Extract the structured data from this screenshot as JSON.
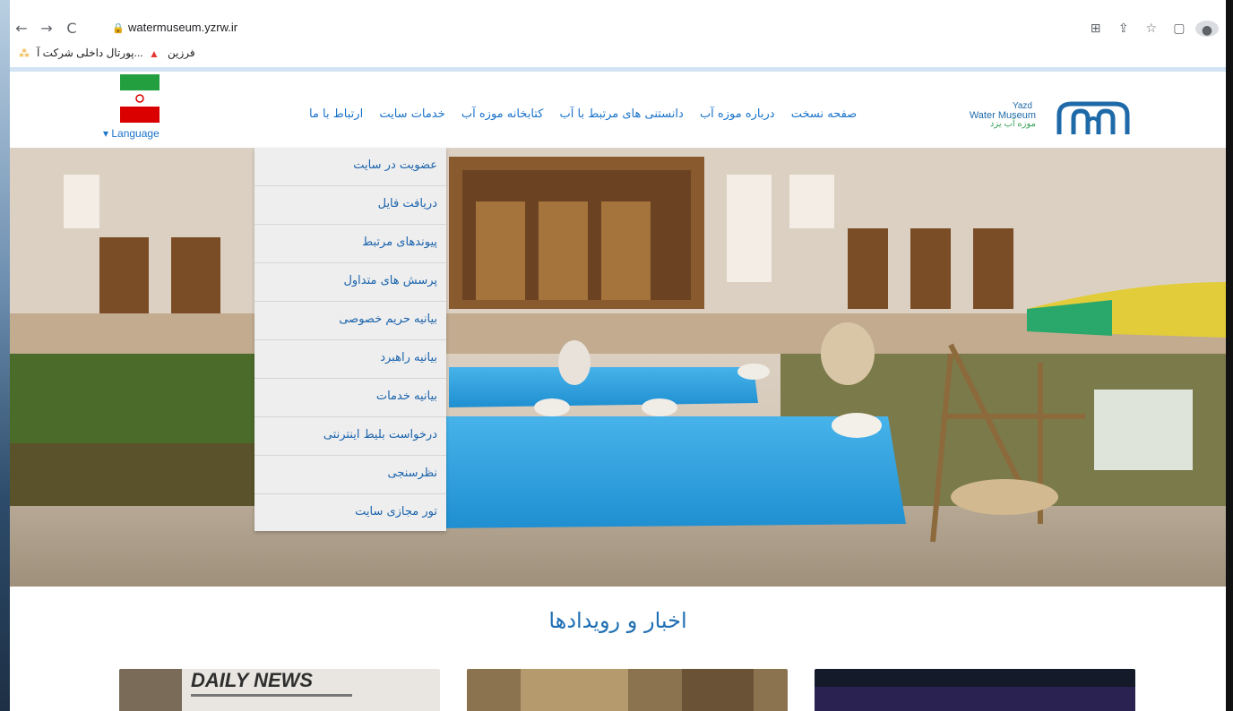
{
  "browser": {
    "url": "watermuseum.yzrw.ir",
    "bookmarks": [
      "فرزین",
      "پورتال داخلی شرکت آ..."
    ]
  },
  "site": {
    "logo": {
      "en_city": "Yazd",
      "en_name": "Water Museum",
      "fa_name": "موزه آب یزد"
    },
    "nav": [
      "صفحه نسخت",
      "درباره موزه آب",
      "دانستنی های مرتبط با آب",
      "کتابخانه موزه آب",
      "خدمات سایت",
      "ارتباط با ما"
    ],
    "language_label": "▾ Language",
    "dropdown": [
      "عضویت در سایت",
      "دریافت فایل",
      "پیوندهای مرتبط",
      "پرسش های متداول",
      "بیانیه حریم خصوصی",
      "بیانیه راهبرد",
      "بیانیه خدمات",
      "درخواست بلیط اینترنتی",
      "نظرسنجی",
      "تور مجازی سایت"
    ],
    "news_title": "اخبار و رویدادها",
    "news_card_text": "DAILY NEWS"
  }
}
